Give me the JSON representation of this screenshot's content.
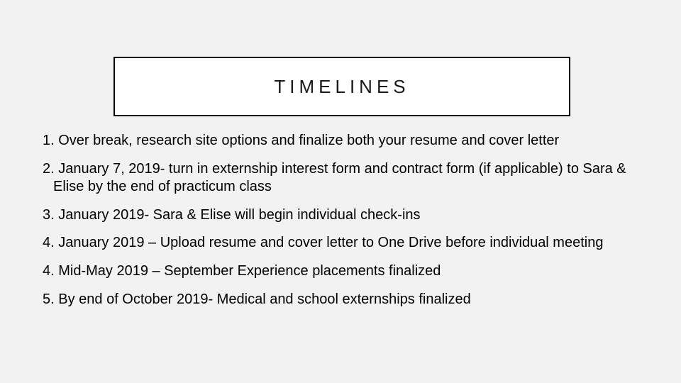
{
  "title": "TIMELINES",
  "items": [
    {
      "num": "1. ",
      "text": "Over break, research site options and finalize both your resume and cover letter"
    },
    {
      "num": "2. ",
      "text": "January 7, 2019- turn in externship interest form and contract form (if applicable) to Sara & Elise by the end of practicum class"
    },
    {
      "num": "3. ",
      "text": "January 2019- Sara & Elise will begin individual check-ins"
    },
    {
      "num": "4. ",
      "text": "January 2019 – Upload resume and cover letter to One Drive before individual meeting"
    },
    {
      "num": "4. ",
      "text": "Mid-May 2019 – September Experience placements finalized"
    },
    {
      "num": "5. ",
      "text": "By end of October 2019- Medical and school externships finalized"
    }
  ]
}
